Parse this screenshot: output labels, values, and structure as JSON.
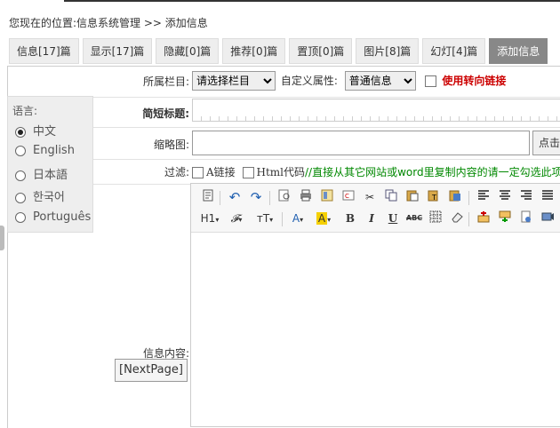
{
  "breadcrumb": {
    "label": "您现在的位置:",
    "path": "信息系统管理 >> 添加信息"
  },
  "tabs": [
    {
      "label": "信息[17]篇"
    },
    {
      "label": "显示[17]篇"
    },
    {
      "label": "隐藏[0]篇"
    },
    {
      "label": "推荐[0]篇"
    },
    {
      "label": "置顶[0]篇"
    },
    {
      "label": "图片[8]篇"
    },
    {
      "label": "幻灯[4]篇"
    },
    {
      "label": "添加信息",
      "active": true
    }
  ],
  "form": {
    "category_label": "所属栏目:",
    "category_value": "请选择栏目",
    "custom_attr_label": "自定义属性:",
    "custom_attr_value": "普通信息",
    "redirect_label": "使用转向链接",
    "title_label": "简短标题:",
    "thumb_label": "缩略图:",
    "thumb_button": "点击",
    "filter_label": "过滤:",
    "filter_a_link": "A链接",
    "filter_html": "Html代码",
    "filter_hint": "//直接从其它网站或word里复制内容的请一定勾选此项",
    "content_label": "信息内容:",
    "nextpage_button": "[NextPage]"
  },
  "language_panel": {
    "heading": "语言:",
    "options": [
      {
        "label": "中文",
        "selected": true
      },
      {
        "label": "English",
        "selected": false
      },
      {
        "label": "日本語",
        "selected": false
      },
      {
        "label": "한국어",
        "selected": false
      },
      {
        "label": "Português",
        "selected": false
      }
    ]
  },
  "editor_toolbar": {
    "row1": [
      "source-icon",
      "undo-icon",
      "redo-icon",
      "preview-icon",
      "print-icon",
      "template-icon",
      "paste-word-icon",
      "cut-icon",
      "copy-icon",
      "paste-icon",
      "paste-text-icon",
      "paste-plain-icon",
      "align-left-icon",
      "align-center-icon",
      "align-right-icon",
      "align-justify-icon"
    ],
    "heading_label": "H1",
    "font_label": "𝓕",
    "size_label": "тT",
    "font_color_label": "A",
    "highlight_label": "A",
    "bold_label": "B",
    "italic_label": "I",
    "underline_label": "U",
    "strike_label": "ABC"
  },
  "colors": {
    "active_tab": "#888888",
    "panel_bg": "#eeeeee",
    "red": "#cc0000",
    "green": "#008800"
  }
}
